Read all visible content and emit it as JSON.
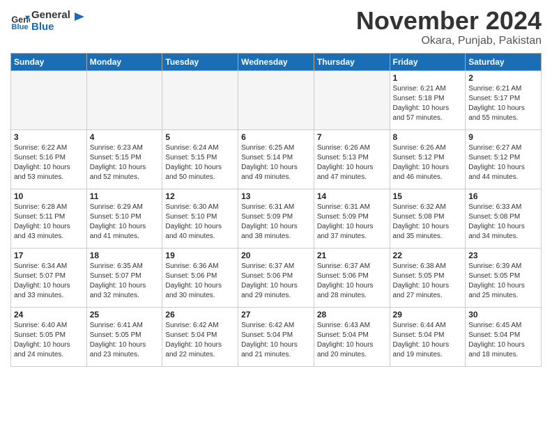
{
  "header": {
    "logo_line1": "General",
    "logo_line2": "Blue",
    "month": "November 2024",
    "location": "Okara, Punjab, Pakistan"
  },
  "weekdays": [
    "Sunday",
    "Monday",
    "Tuesday",
    "Wednesday",
    "Thursday",
    "Friday",
    "Saturday"
  ],
  "weeks": [
    [
      {
        "day": "",
        "empty": true
      },
      {
        "day": "",
        "empty": true
      },
      {
        "day": "",
        "empty": true
      },
      {
        "day": "",
        "empty": true
      },
      {
        "day": "",
        "empty": true
      },
      {
        "day": "1",
        "sunrise": "6:21 AM",
        "sunset": "5:18 PM",
        "daylight": "10 hours and 57 minutes."
      },
      {
        "day": "2",
        "sunrise": "6:21 AM",
        "sunset": "5:17 PM",
        "daylight": "10 hours and 55 minutes."
      }
    ],
    [
      {
        "day": "3",
        "sunrise": "6:22 AM",
        "sunset": "5:16 PM",
        "daylight": "10 hours and 53 minutes."
      },
      {
        "day": "4",
        "sunrise": "6:23 AM",
        "sunset": "5:15 PM",
        "daylight": "10 hours and 52 minutes."
      },
      {
        "day": "5",
        "sunrise": "6:24 AM",
        "sunset": "5:15 PM",
        "daylight": "10 hours and 50 minutes."
      },
      {
        "day": "6",
        "sunrise": "6:25 AM",
        "sunset": "5:14 PM",
        "daylight": "10 hours and 49 minutes."
      },
      {
        "day": "7",
        "sunrise": "6:26 AM",
        "sunset": "5:13 PM",
        "daylight": "10 hours and 47 minutes."
      },
      {
        "day": "8",
        "sunrise": "6:26 AM",
        "sunset": "5:12 PM",
        "daylight": "10 hours and 46 minutes."
      },
      {
        "day": "9",
        "sunrise": "6:27 AM",
        "sunset": "5:12 PM",
        "daylight": "10 hours and 44 minutes."
      }
    ],
    [
      {
        "day": "10",
        "sunrise": "6:28 AM",
        "sunset": "5:11 PM",
        "daylight": "10 hours and 43 minutes."
      },
      {
        "day": "11",
        "sunrise": "6:29 AM",
        "sunset": "5:10 PM",
        "daylight": "10 hours and 41 minutes."
      },
      {
        "day": "12",
        "sunrise": "6:30 AM",
        "sunset": "5:10 PM",
        "daylight": "10 hours and 40 minutes."
      },
      {
        "day": "13",
        "sunrise": "6:31 AM",
        "sunset": "5:09 PM",
        "daylight": "10 hours and 38 minutes."
      },
      {
        "day": "14",
        "sunrise": "6:31 AM",
        "sunset": "5:09 PM",
        "daylight": "10 hours and 37 minutes."
      },
      {
        "day": "15",
        "sunrise": "6:32 AM",
        "sunset": "5:08 PM",
        "daylight": "10 hours and 35 minutes."
      },
      {
        "day": "16",
        "sunrise": "6:33 AM",
        "sunset": "5:08 PM",
        "daylight": "10 hours and 34 minutes."
      }
    ],
    [
      {
        "day": "17",
        "sunrise": "6:34 AM",
        "sunset": "5:07 PM",
        "daylight": "10 hours and 33 minutes."
      },
      {
        "day": "18",
        "sunrise": "6:35 AM",
        "sunset": "5:07 PM",
        "daylight": "10 hours and 32 minutes."
      },
      {
        "day": "19",
        "sunrise": "6:36 AM",
        "sunset": "5:06 PM",
        "daylight": "10 hours and 30 minutes."
      },
      {
        "day": "20",
        "sunrise": "6:37 AM",
        "sunset": "5:06 PM",
        "daylight": "10 hours and 29 minutes."
      },
      {
        "day": "21",
        "sunrise": "6:37 AM",
        "sunset": "5:06 PM",
        "daylight": "10 hours and 28 minutes."
      },
      {
        "day": "22",
        "sunrise": "6:38 AM",
        "sunset": "5:05 PM",
        "daylight": "10 hours and 27 minutes."
      },
      {
        "day": "23",
        "sunrise": "6:39 AM",
        "sunset": "5:05 PM",
        "daylight": "10 hours and 25 minutes."
      }
    ],
    [
      {
        "day": "24",
        "sunrise": "6:40 AM",
        "sunset": "5:05 PM",
        "daylight": "10 hours and 24 minutes."
      },
      {
        "day": "25",
        "sunrise": "6:41 AM",
        "sunset": "5:05 PM",
        "daylight": "10 hours and 23 minutes."
      },
      {
        "day": "26",
        "sunrise": "6:42 AM",
        "sunset": "5:04 PM",
        "daylight": "10 hours and 22 minutes."
      },
      {
        "day": "27",
        "sunrise": "6:42 AM",
        "sunset": "5:04 PM",
        "daylight": "10 hours and 21 minutes."
      },
      {
        "day": "28",
        "sunrise": "6:43 AM",
        "sunset": "5:04 PM",
        "daylight": "10 hours and 20 minutes."
      },
      {
        "day": "29",
        "sunrise": "6:44 AM",
        "sunset": "5:04 PM",
        "daylight": "10 hours and 19 minutes."
      },
      {
        "day": "30",
        "sunrise": "6:45 AM",
        "sunset": "5:04 PM",
        "daylight": "10 hours and 18 minutes."
      }
    ]
  ],
  "labels": {
    "sunrise": "Sunrise:",
    "sunset": "Sunset:",
    "daylight": "Daylight:"
  },
  "colors": {
    "header_bg": "#1a6eb5",
    "header_text": "#ffffff"
  }
}
